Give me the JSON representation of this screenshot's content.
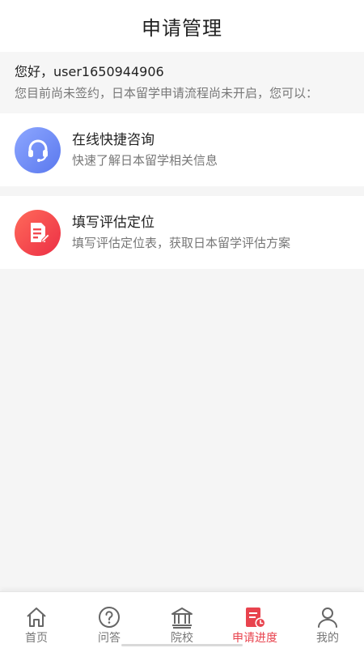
{
  "header": {
    "title": "申请管理"
  },
  "greeting": {
    "hello": "您好，user1650944906",
    "status": "您目前尚未签约，日本留学申请流程尚未开启，您可以："
  },
  "cards": [
    {
      "title": "在线快捷咨询",
      "subtitle": "快速了解日本留学相关信息",
      "icon": "headset-icon"
    },
    {
      "title": "填写评估定位",
      "subtitle": "填写评估定位表，获取日本留学评估方案",
      "icon": "form-edit-icon"
    }
  ],
  "tabbar": {
    "items": [
      {
        "label": "首页",
        "icon": "home-icon"
      },
      {
        "label": "问答",
        "icon": "question-icon"
      },
      {
        "label": "院校",
        "icon": "school-icon"
      },
      {
        "label": "申请进度",
        "icon": "progress-icon",
        "active": true
      },
      {
        "label": "我的",
        "icon": "user-icon"
      }
    ]
  },
  "colors": {
    "accent": "#e8434e",
    "blue": "#6f8cf5",
    "red": "#f24a50"
  }
}
